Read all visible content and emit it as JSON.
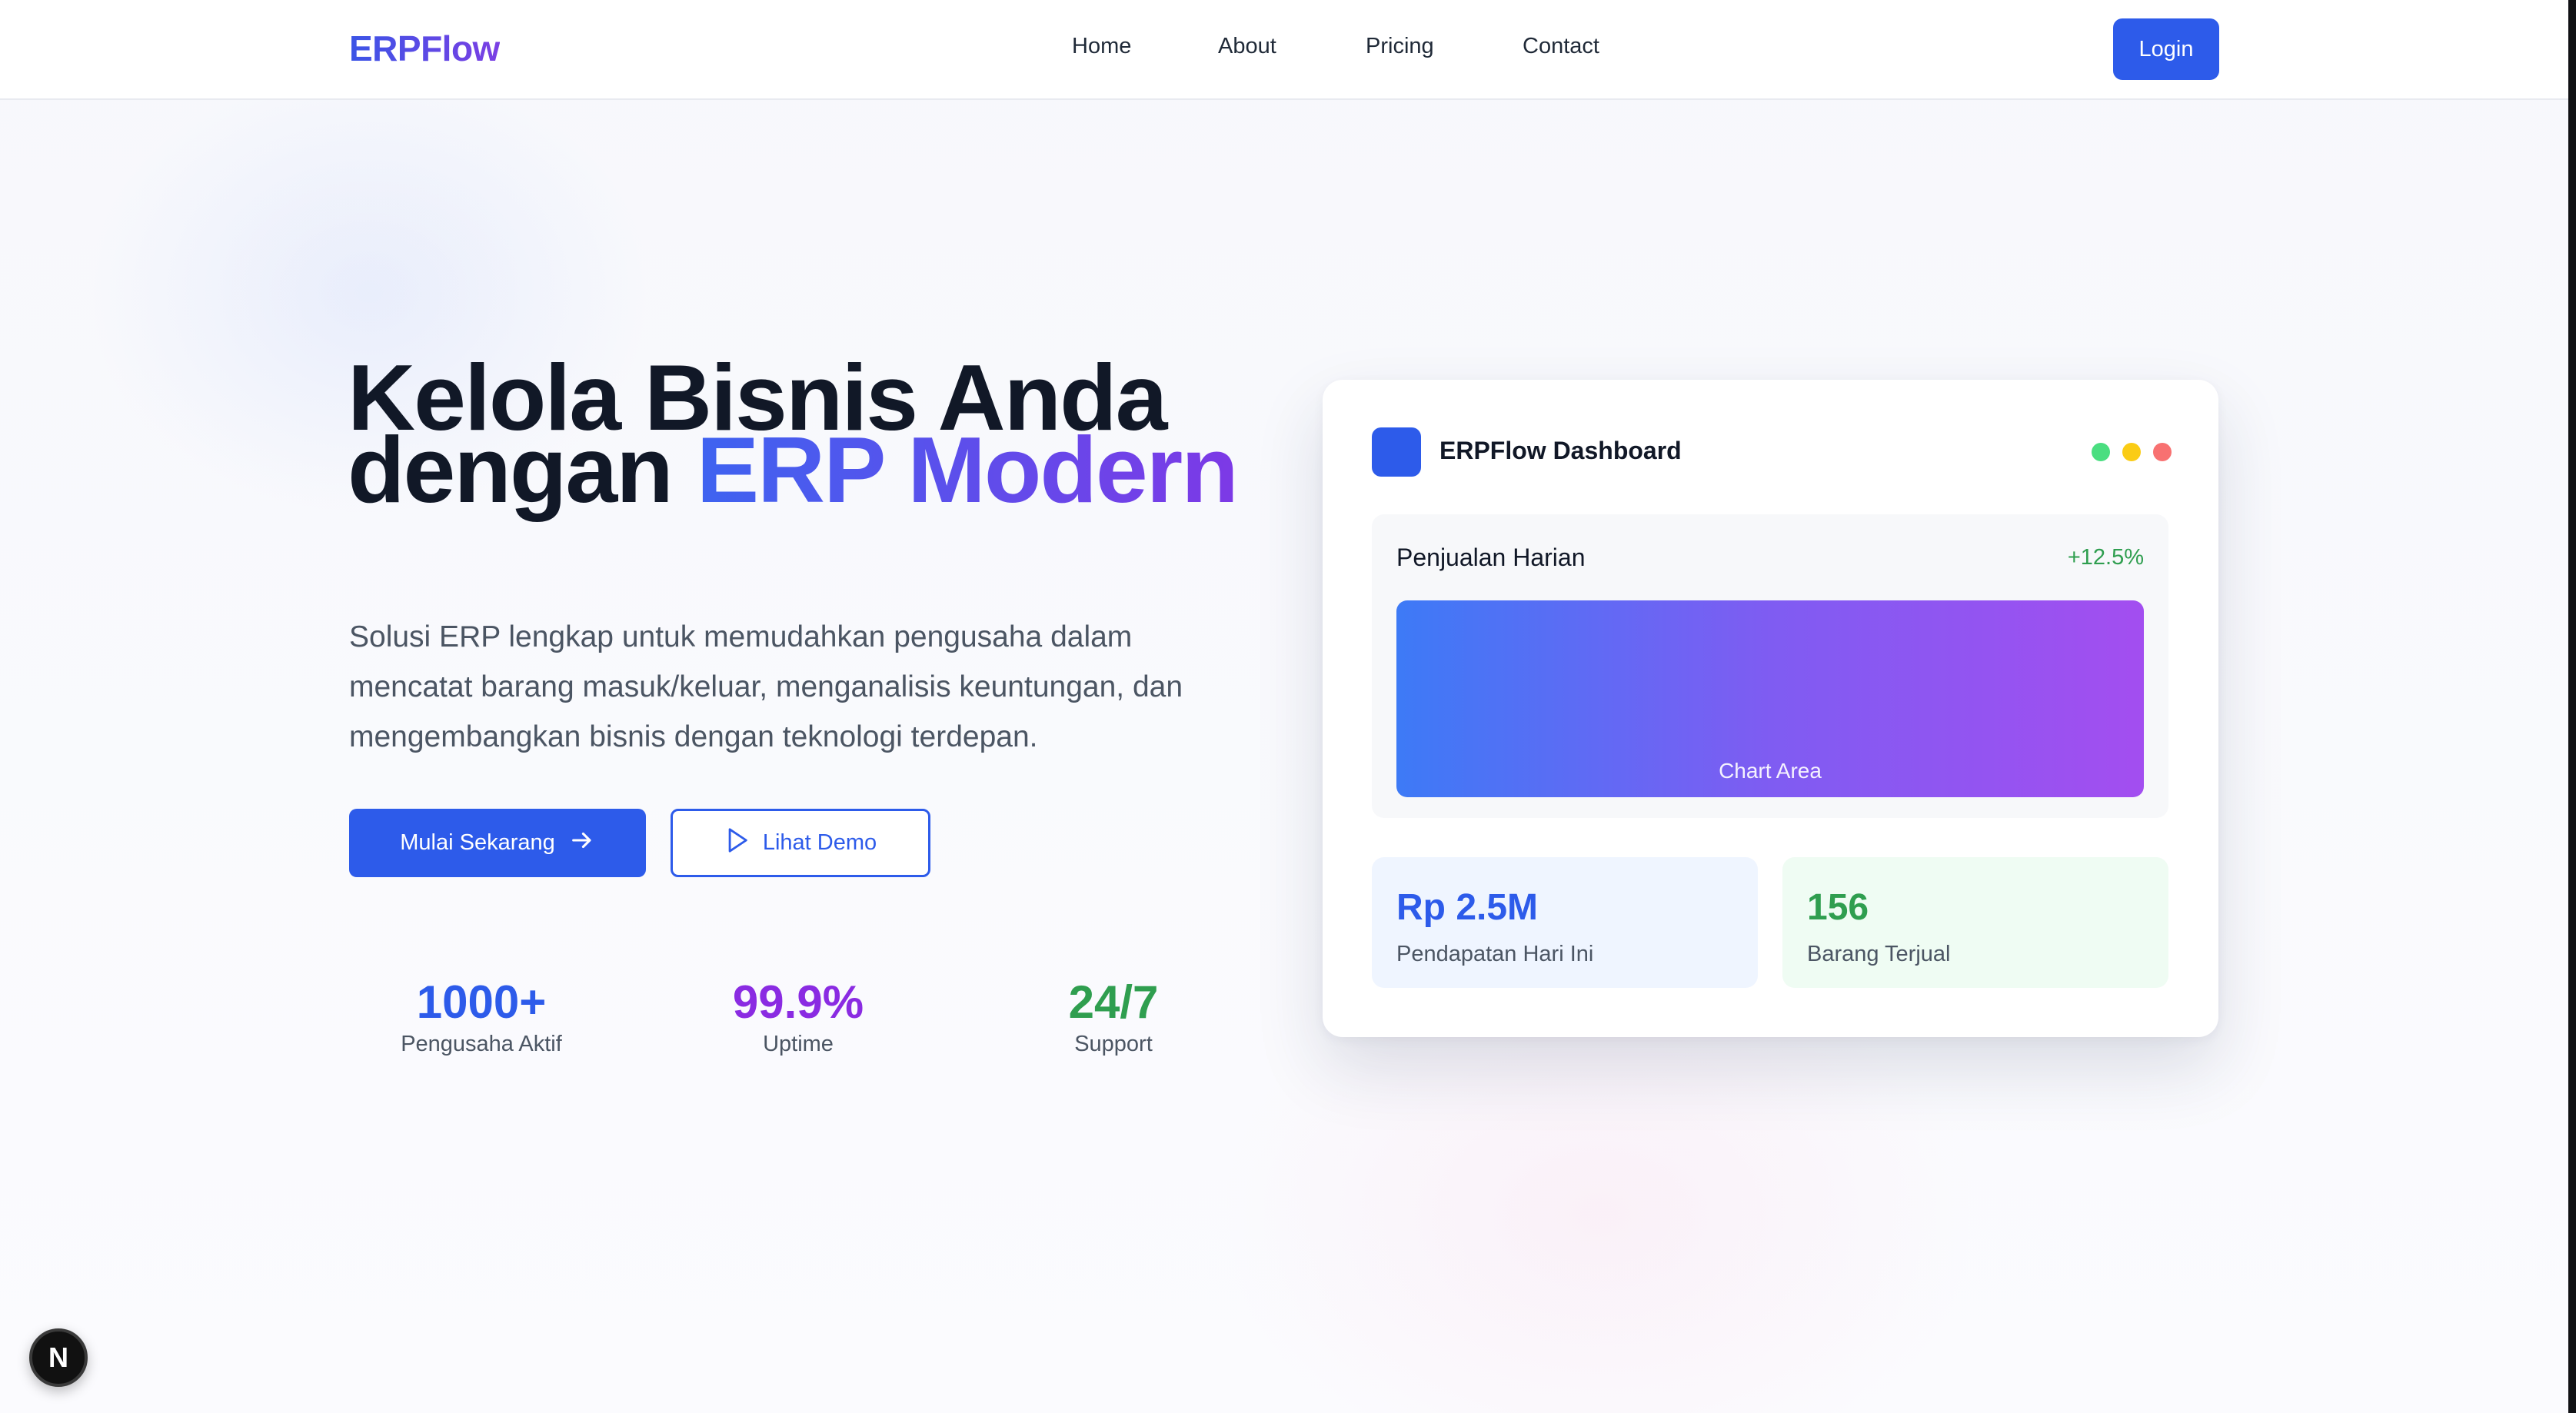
{
  "nav": {
    "logo": "ERPFlow",
    "links": [
      "Home",
      "About",
      "Pricing",
      "Contact"
    ],
    "login_label": "Login"
  },
  "hero": {
    "title_line1": "Kelola Bisnis Anda",
    "title_line2_prefix": "dengan ",
    "title_line2_highlight": "ERP Modern",
    "description": "Solusi ERP lengkap untuk memudahkan pengusaha dalam mencatat barang masuk/keluar, menganalisis keuntungan, dan mengembangkan bisnis dengan teknologi terdepan.",
    "primary_button": "Mulai Sekarang",
    "secondary_button": "Lihat Demo"
  },
  "stats": [
    {
      "value": "1000+",
      "label": "Pengusaha Aktif",
      "color": "#2d5bea"
    },
    {
      "value": "99.9%",
      "label": "Uptime",
      "color": "#8a2be2"
    },
    {
      "value": "24/7",
      "label": "Support",
      "color": "#2f9e4f"
    }
  ],
  "dashboard": {
    "title": "ERPFlow Dashboard",
    "window_dots": [
      "#4ade80",
      "#facc15",
      "#f87171"
    ],
    "sales": {
      "title": "Penjualan Harian",
      "change": "+12.5%",
      "chart_placeholder": "Chart Area"
    },
    "metrics": [
      {
        "value": "Rp 2.5M",
        "label": "Pendapatan Hari Ini",
        "color": "#2d5bea",
        "bg": "#eff5ff"
      },
      {
        "value": "156",
        "label": "Barang Terjual",
        "color": "#2f9e4f",
        "bg": "#effcf3"
      }
    ]
  },
  "badge": {
    "letter": "N"
  },
  "colors": {
    "accent": "#2d5bea",
    "brand_gradient_end": "#7d39e6"
  }
}
